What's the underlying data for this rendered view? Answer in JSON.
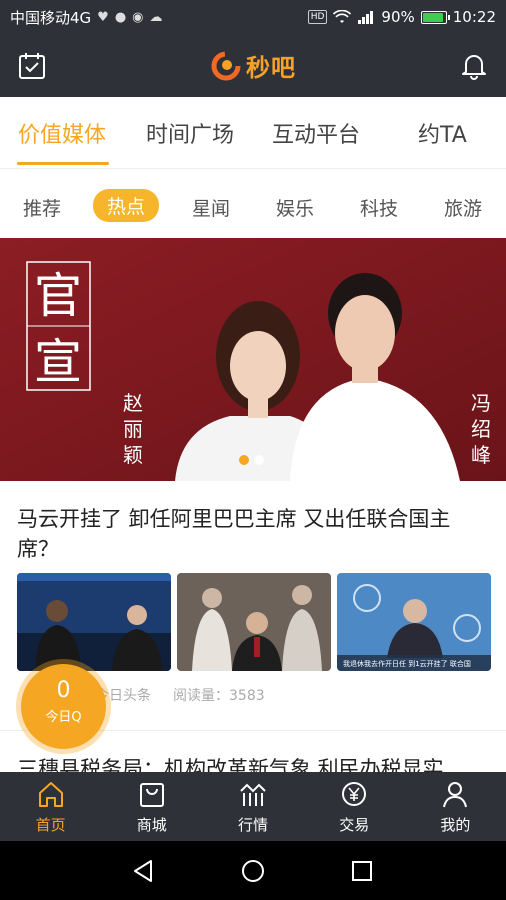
{
  "status_bar": {
    "carrier": "中国移动4G",
    "hd": "HD",
    "battery": "90%",
    "battery_level": 0.9,
    "time": "10:22"
  },
  "app_bar": {
    "logo_text": "秒吧",
    "left_icon": "calendar-check-icon",
    "right_icon": "bell-icon"
  },
  "tabs": [
    {
      "label": "价值媒体",
      "active": true
    },
    {
      "label": "时间广场",
      "active": false
    },
    {
      "label": "互动平台",
      "active": false
    },
    {
      "label": "约TA",
      "active": false
    }
  ],
  "categories": [
    {
      "label": "推荐"
    },
    {
      "label": "热点",
      "active": true
    },
    {
      "label": "星闻"
    },
    {
      "label": "娱乐"
    },
    {
      "label": "科技"
    },
    {
      "label": "旅游"
    }
  ],
  "banner": {
    "stamp_chars": [
      "官",
      "宣"
    ],
    "left_name": [
      "赵",
      "丽",
      "颖"
    ],
    "right_name": [
      "冯",
      "绍",
      "峰"
    ],
    "pages": 2,
    "active_page": 1
  },
  "article": {
    "title": "马云开挂了 卸任阿里巴巴主席 又出任联合国主席？",
    "source": "今日头条",
    "read_label": "阅读量：",
    "read_count": "3583",
    "thumb3_caption": "我退休我去作开日任 到1云开挂了 联合国"
  },
  "float_button": {
    "count": "0",
    "label": "今日Q"
  },
  "next_article": {
    "title": "三穗县税务局：机构改革新气象 利民办税显实"
  },
  "bottom_nav": [
    {
      "label": "首页",
      "icon": "home-icon",
      "active": true
    },
    {
      "label": "商城",
      "icon": "shopping-bag-icon"
    },
    {
      "label": "行情",
      "icon": "market-chart-icon"
    },
    {
      "label": "交易",
      "icon": "yuan-exchange-icon"
    },
    {
      "label": "我的",
      "icon": "user-icon"
    }
  ],
  "colors": {
    "accent": "#f5a623",
    "bar_dark": "#2e3138",
    "banner_red": "#7d1a20"
  }
}
